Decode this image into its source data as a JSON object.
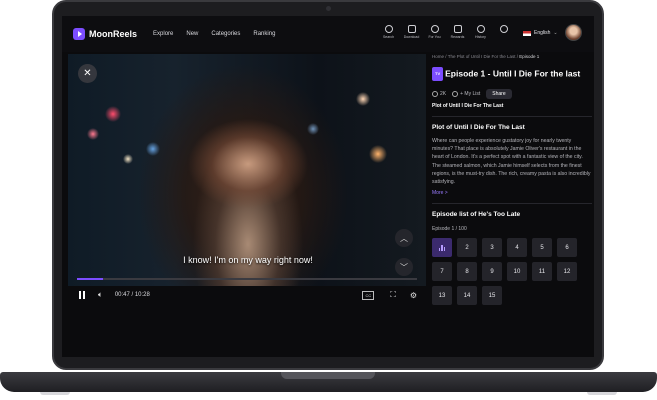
{
  "nav": {
    "brand": "MoonReels",
    "links": [
      "Explore",
      "New",
      "Categories",
      "Ranking"
    ],
    "icons": [
      {
        "label": "Search",
        "icon": "search-icon"
      },
      {
        "label": "Download",
        "icon": "download-icon"
      },
      {
        "label": "For You",
        "icon": "heart-icon"
      },
      {
        "label": "Rewards",
        "icon": "gift-icon"
      },
      {
        "label": "History",
        "icon": "history-icon"
      },
      {
        "label": "",
        "icon": "clock-icon"
      }
    ],
    "language": "English"
  },
  "player": {
    "subtitle": "I know! I'm on my way right now!",
    "time": "00:47 / 10:28",
    "progress": 0.075,
    "cc_label": "CC"
  },
  "panel": {
    "breadcrumb": {
      "home": "Home",
      "sep": "/",
      "middle": "The Plot of Until I Die For the Last",
      "current": "Episode 1"
    },
    "episode_title": "Episode 1 - Until I Die For the last",
    "tag": "TV",
    "likes": "2K",
    "my_list": "+ My List",
    "share": "Share",
    "hover_title": "Plot of Until I Die For The Last",
    "plot_title": "Plot of Until I Die For The Last",
    "plot_text": "Where can people experience gustatory joy for nearly twenty minutes? That place is absolutely Jamie Oliver's restaurant in the heart of London. It's a perfect spot with a fantastic view of the city. The steamed salmon, which Jamie himself selects from the finest regions, is the must-try dish. The rich, creamy pasta is also incredibly satisfying.",
    "more": "More >",
    "episode_list_title": "Episode list of He's Too Late",
    "episode_range": "Episode 1 / 100",
    "episodes": [
      "",
      "2",
      "3",
      "4",
      "5",
      "6",
      "7",
      "8",
      "9",
      "10",
      "11",
      "12",
      "13",
      "14",
      "15"
    ]
  },
  "colors": {
    "accent": "#7c4dff",
    "background": "#0b0b0d"
  }
}
